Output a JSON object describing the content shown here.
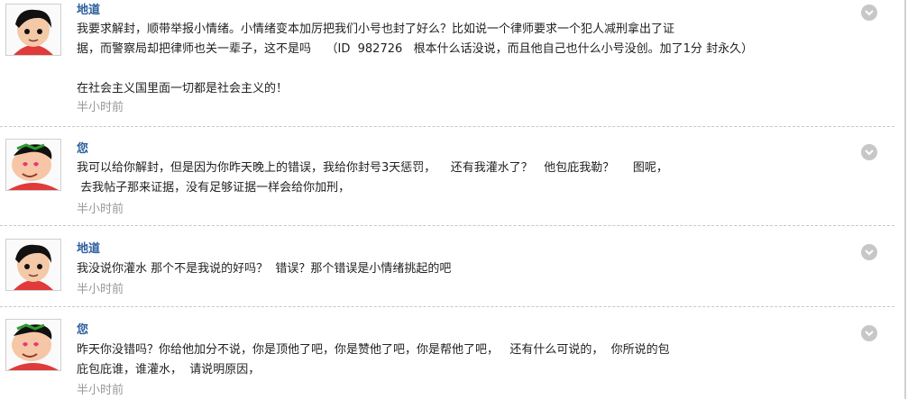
{
  "messages": [
    {
      "author": "地道",
      "avatar": "boy-avatar",
      "lines": [
        "我要求解封，顺带举报小情绪。小情绪变本加厉把我们小号也封了好么？比如说一个律师要求一个犯人减刑拿出了证",
        "据，而警察局却把律师也关一辈子，这不是吗    （ID  982726   根本什么话没说，而且他自己也什么小号没创。加了1分 封永久）",
        "",
        "在社会主义国里面一切都是社会主义的！"
      ],
      "time": "半小时前",
      "menu_icon": "chevron-down-icon"
    },
    {
      "author": "您",
      "avatar": "crayon-shin-chan-avatar",
      "lines": [
        "我可以给你解封，但是因为你昨天晚上的错误，我给你封号3天惩罚，    还有我灌水了？   他包庇我勒？     图呢，",
        " 去我帖子那来证据，没有足够证据一样会给你加刑，"
      ],
      "time": "半小时前",
      "menu_icon": "chevron-down-icon"
    },
    {
      "author": "地道",
      "avatar": "boy-avatar",
      "lines": [
        "我没说你灌水 那个不是我说的好吗？  错误？那个错误是小情绪挑起的吧"
      ],
      "time": "半小时前",
      "menu_icon": "chevron-down-icon"
    },
    {
      "author": "您",
      "avatar": "crayon-shin-chan-avatar",
      "lines": [
        "昨天你没错吗？你给他加分不说，你是顶他了吧，你是赞他了吧，你是帮他了吧，   还有什么可说的，  你所说的包",
        "庇包庇谁，谁灌水，  请说明原因，"
      ],
      "time": "半小时前",
      "menu_icon": "chevron-down-icon"
    }
  ]
}
